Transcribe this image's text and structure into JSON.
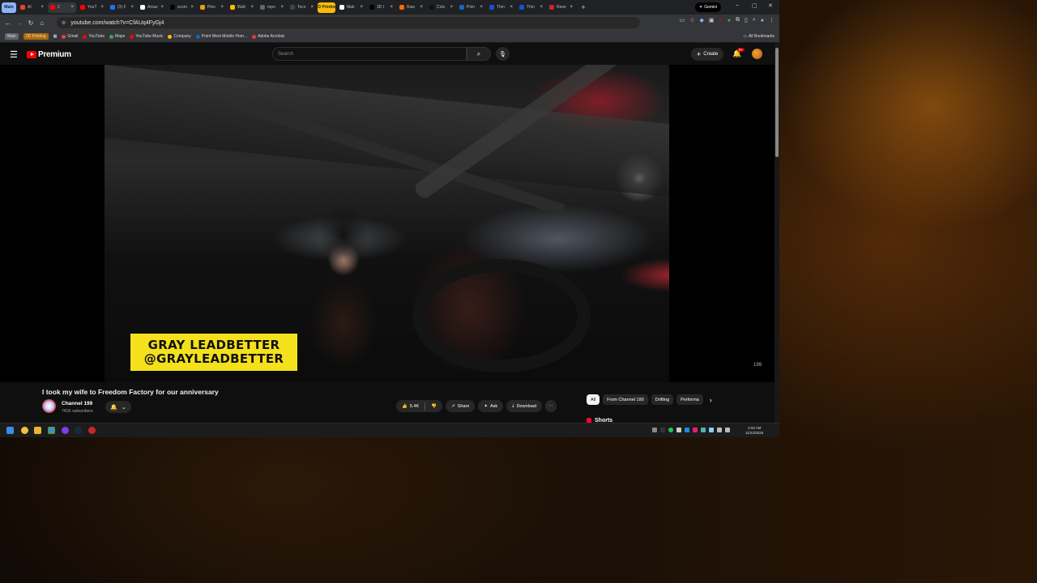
{
  "browser": {
    "tab_groups": [
      {
        "label": "Main"
      },
      {
        "label": "3D Printing"
      }
    ],
    "tabs": [
      {
        "label": "AI",
        "color": "#ea4335"
      },
      {
        "label": "2",
        "color": "#ff0000",
        "active": true
      },
      {
        "label": "YouT",
        "color": "#ff0000"
      },
      {
        "label": "(3) F",
        "color": "#1877f2"
      },
      {
        "label": "Amaz",
        "color": "#ffffff"
      },
      {
        "label": "xcom",
        "color": "#000000"
      },
      {
        "label": "Plex",
        "color": "#e5a00d"
      },
      {
        "label": "Walt",
        "color": "#fbbc04"
      },
      {
        "label": "mpo",
        "color": "#666666"
      },
      {
        "label": "Toco",
        "color": "#444444"
      },
      {
        "label": "Mak",
        "color": "#ffffff"
      },
      {
        "label": "3D I",
        "color": "#000000"
      },
      {
        "label": "Raw",
        "color": "#ff6a00"
      },
      {
        "label": "Colo",
        "color": "#111111"
      },
      {
        "label": "Poin",
        "color": "#1565c0"
      },
      {
        "label": "Thin",
        "color": "#1a4fd6"
      },
      {
        "label": "Thin",
        "color": "#1a4fd6"
      },
      {
        "label": "Rese",
        "color": "#c62828"
      }
    ],
    "gemini_label": "Gemini",
    "url": "youtube.com/watch?v=CfAUq4FyGj4",
    "bookmarks": [
      {
        "label": "Main",
        "style": "pill"
      },
      {
        "label": "3D Printing",
        "style": "pill2"
      },
      {
        "label": "Gmail",
        "color": "#ea4335"
      },
      {
        "label": "YouTube",
        "color": "#ff0000"
      },
      {
        "label": "Maps",
        "color": "#34a853"
      },
      {
        "label": "YouTube Music",
        "color": "#ff0000"
      },
      {
        "label": "Company",
        "color": "#fbbc04"
      },
      {
        "label": "Point West Mobile Hom...",
        "color": "#1565c0"
      },
      {
        "label": "Adobe Acrobat",
        "color": "#e53935"
      }
    ],
    "all_bookmarks": "All Bookmarks"
  },
  "youtube": {
    "logo_text": "Premium",
    "search_placeholder": "Search",
    "create_label": "Create",
    "notification_count": "9+",
    "video_overlay_line1": "GRAY LEADBETTER",
    "video_overlay_line2": "@GRAYLEADBETTER",
    "watermark": "199",
    "video_title": "I took my wife to Freedom Factory for our anniversary",
    "channel_name": "Channel 199",
    "subscribers": "741K subscribers",
    "likes": "5.4K",
    "share_label": "Share",
    "ask_label": "Ask",
    "download_label": "Download",
    "chips": [
      {
        "label": "All",
        "active": true
      },
      {
        "label": "From Channel 199"
      },
      {
        "label": "Drifting"
      },
      {
        "label": "Performa"
      }
    ],
    "shorts_label": "Shorts"
  },
  "taskbar": {
    "time": "4:03 AM",
    "date": "11/22/2025"
  }
}
